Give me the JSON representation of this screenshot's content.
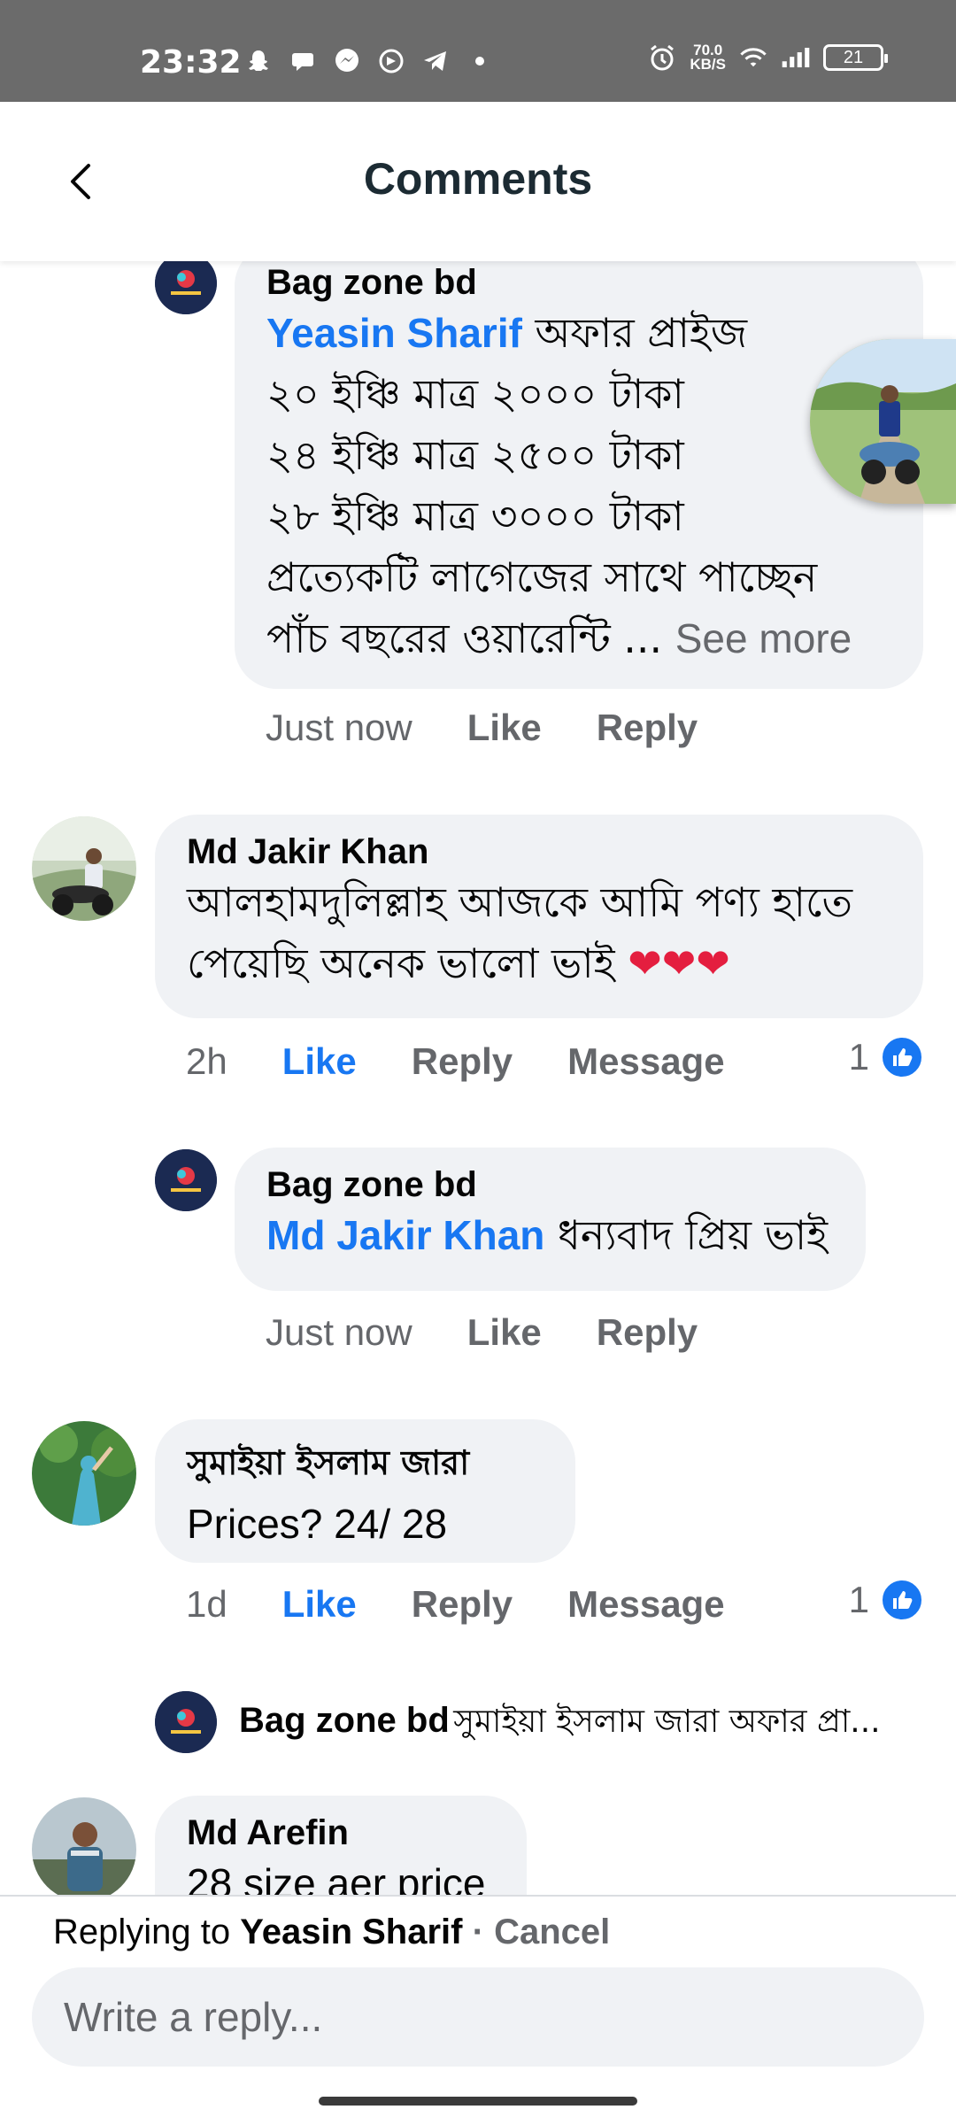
{
  "status_bar": {
    "time": "23:32",
    "speed_value": "70.0",
    "speed_unit": "KB/S",
    "battery": "21"
  },
  "header": {
    "title": "Comments"
  },
  "comments": [
    {
      "author": "Bag zone bd",
      "mention": "Yeasin Sharif",
      "lines": [
        "অফার প্রাইজ",
        "২০ ইঞ্চি মাত্র ২০০০ টাকা",
        "২৪ ইঞ্চি মাত্র ২৫০০ টাকা",
        "২৮ ইঞ্চি মাত্র ৩০০০ টাকা",
        "প্রত্যেকটি লাগেজের সাথে পাচ্ছেন",
        "পাঁচ বছরের ওয়ারেন্টি ..."
      ],
      "see_more": "See more",
      "time": "Just now",
      "like": "Like",
      "reply": "Reply"
    },
    {
      "author": "Md Jakir Khan",
      "line1": "আলহামদুলিল্লাহ আজকে আমি পণ্য হাতে",
      "line2": "পেয়েছি  অনেক ভালো ভাই",
      "hearts": "❤❤❤",
      "time": "2h",
      "like": "Like",
      "reply": "Reply",
      "message": "Message",
      "like_count": "1"
    },
    {
      "author": "Bag zone bd",
      "mention": "Md Jakir Khan",
      "text": "ধন্যবাদ প্রিয় ভাই",
      "time": "Just now",
      "like": "Like",
      "reply": "Reply"
    },
    {
      "author": "সুমাইয়া ইসলাম জারা",
      "text": "Prices?  24/ 28",
      "time": "1d",
      "like": "Like",
      "reply": "Reply",
      "message": "Message",
      "like_count": "1"
    },
    {
      "author": "Bag zone bd",
      "preview": "সুমাইয়া ইসলাম জারা অফার প্রা..."
    },
    {
      "author": "Md Arefin",
      "text": "28 size aer price"
    }
  ],
  "reply_bar": {
    "replying_to_prefix": "Replying to",
    "replying_to_name": "Yeasin Sharif",
    "separator": "·",
    "cancel": "Cancel",
    "placeholder": "Write a reply..."
  },
  "colors": {
    "accent": "#1877f2",
    "bubble": "#f0f2f5",
    "secondary_text": "#65676b",
    "status_bar": "#6b6b6b"
  },
  "icons": [
    "back-arrow-icon",
    "snapchat-icon",
    "chat-icon",
    "messenger-icon",
    "messenger-outline-icon",
    "telegram-icon",
    "dot-icon",
    "alarm-icon",
    "wifi-icon",
    "signal-icon",
    "battery-icon",
    "thumbs-up-icon"
  ]
}
